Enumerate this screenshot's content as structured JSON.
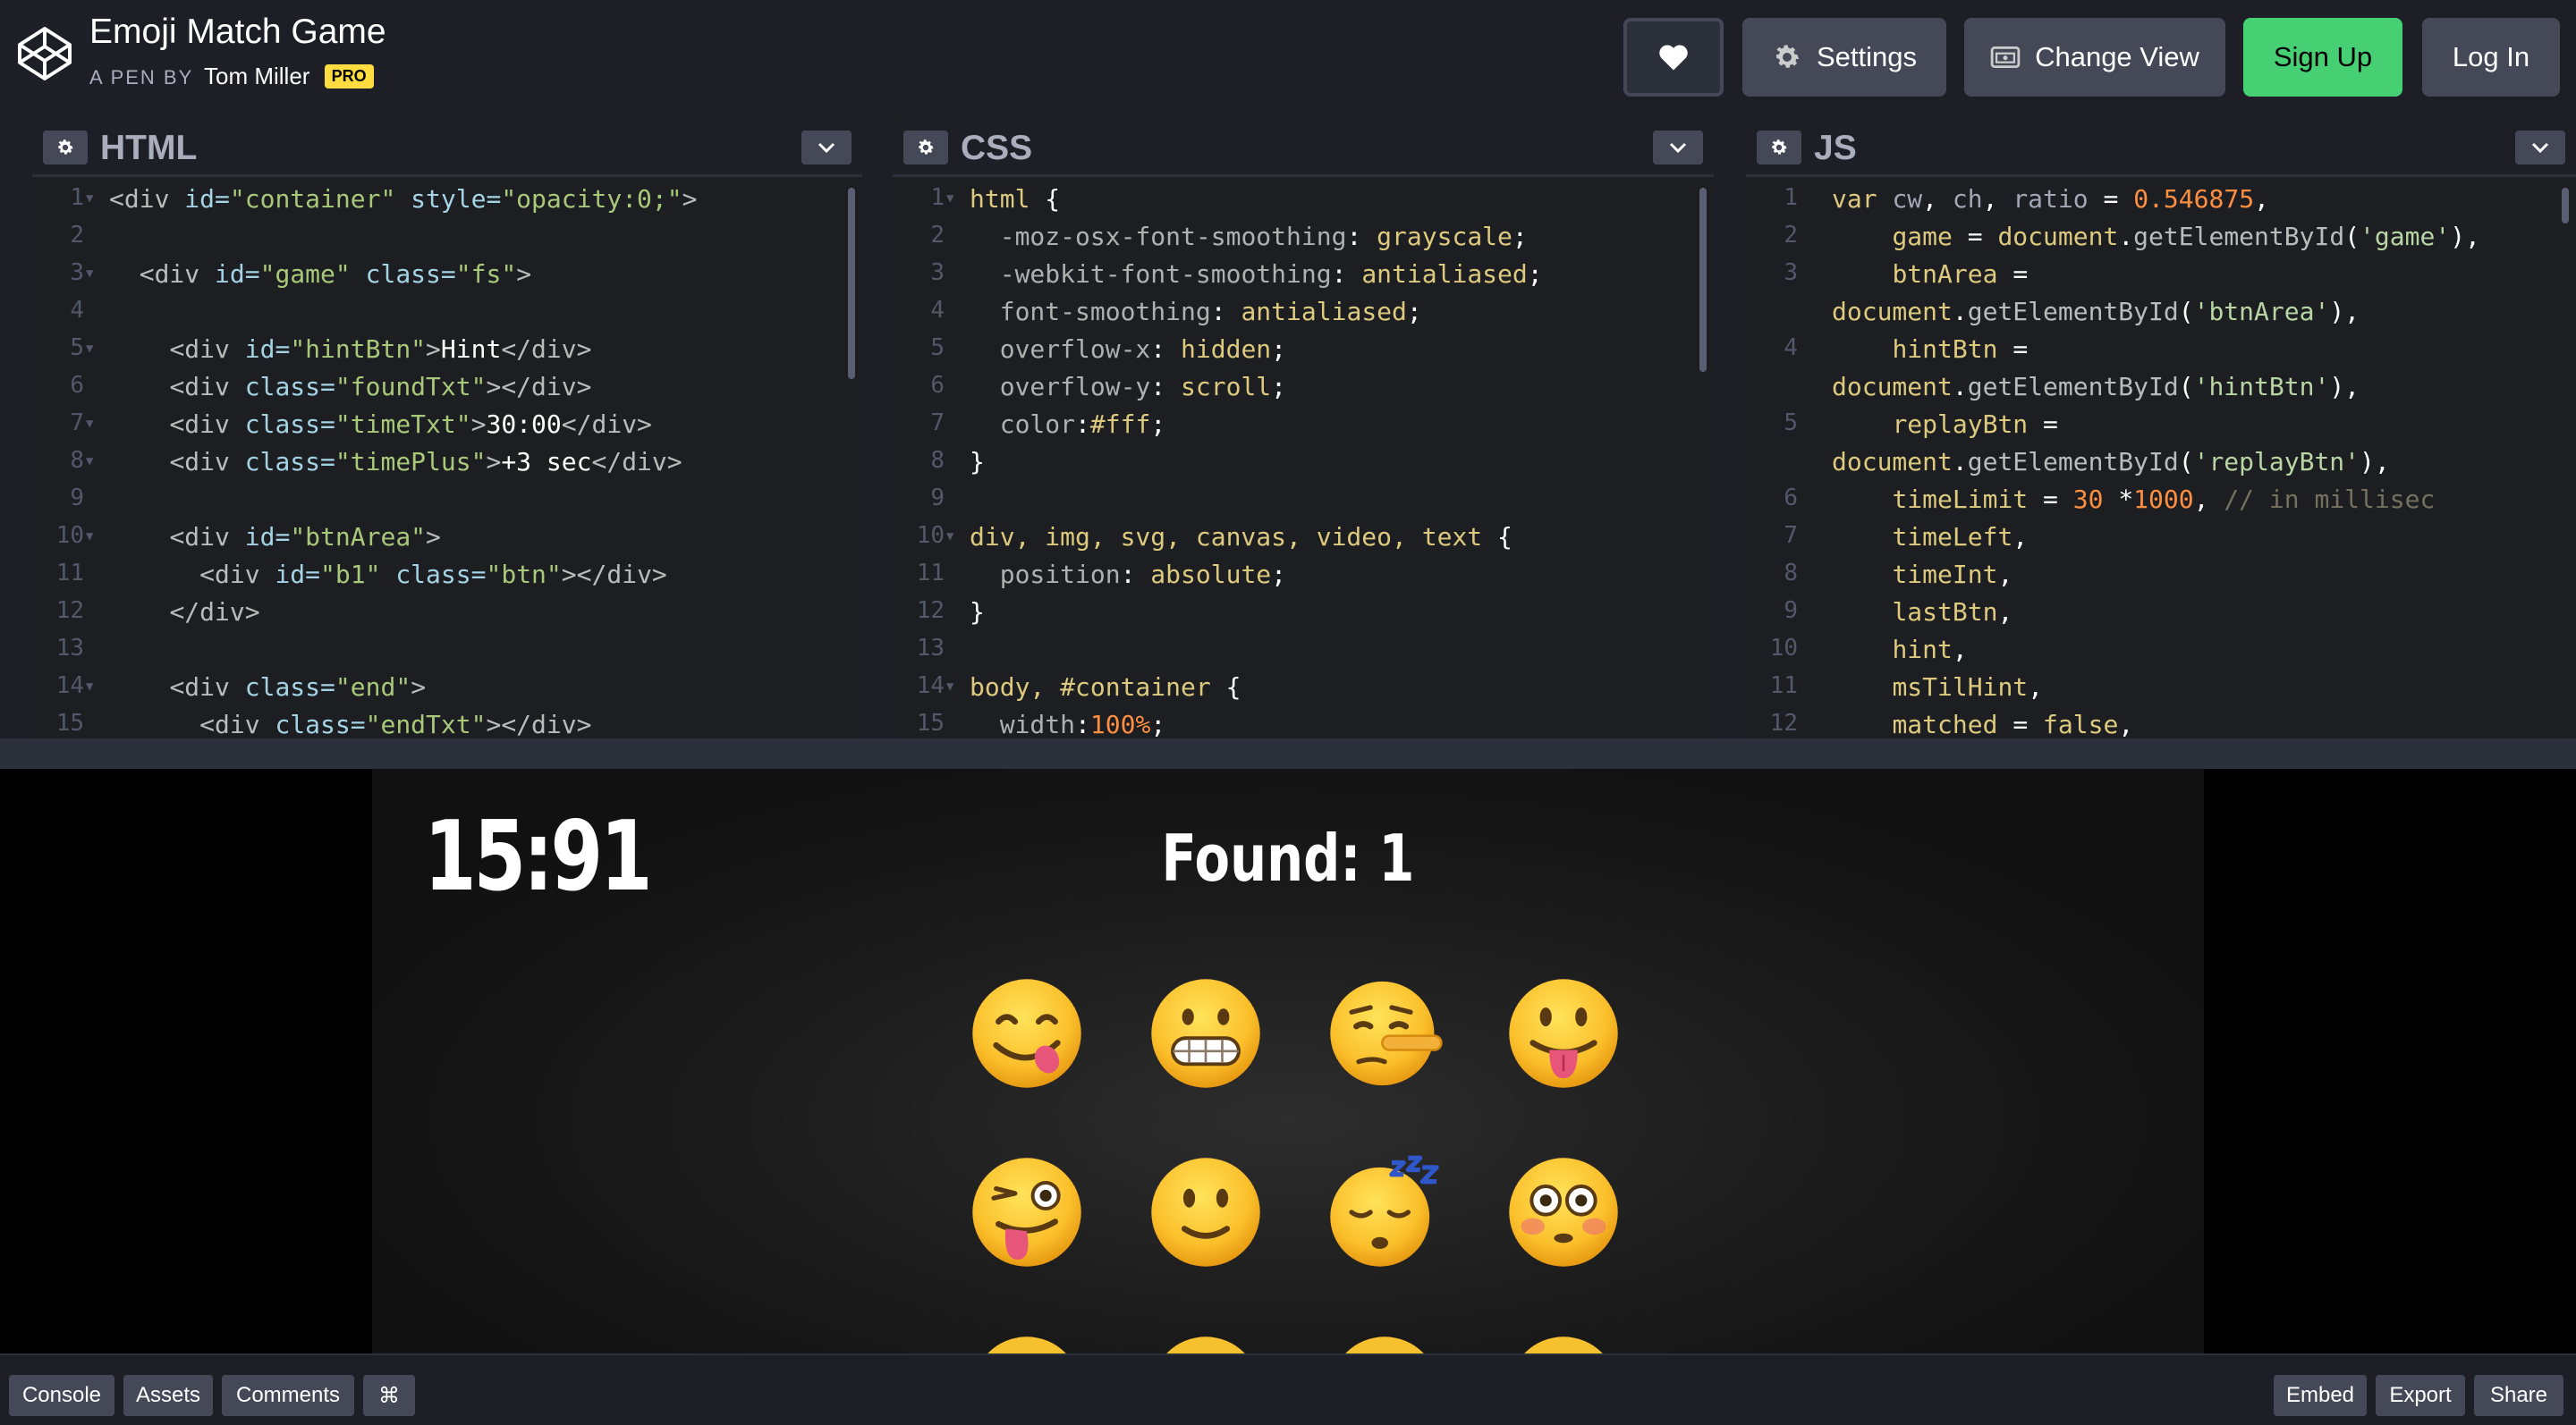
{
  "header": {
    "title": "Emoji Match Game",
    "byline_prefix": "A PEN BY",
    "author": "Tom Miller",
    "badge": "PRO",
    "buttons": {
      "settings": "Settings",
      "change_view": "Change View",
      "sign_up": "Sign Up",
      "log_in": "Log In"
    }
  },
  "panes": {
    "html": {
      "label": "HTML"
    },
    "css": {
      "label": "CSS"
    },
    "js": {
      "label": "JS"
    }
  },
  "preview": {
    "timer": "15:91",
    "found": "Found: 1",
    "emoji_grid": [
      [
        "face-savoring-food",
        "grimacing-face",
        "lying-face",
        "face-with-tongue"
      ],
      [
        "winking-face-with-tongue",
        "slightly-smiling-face",
        "sleeping-face",
        "flushed-face"
      ]
    ]
  },
  "footer": {
    "console": "Console",
    "assets": "Assets",
    "comments": "Comments",
    "shortcuts": "⌘",
    "embed": "Embed",
    "export": "Export",
    "share": "Share"
  },
  "colors": {
    "accent_green": "#47cf73",
    "button_gray": "#444857",
    "pro_yellow": "#ffdd40"
  }
}
